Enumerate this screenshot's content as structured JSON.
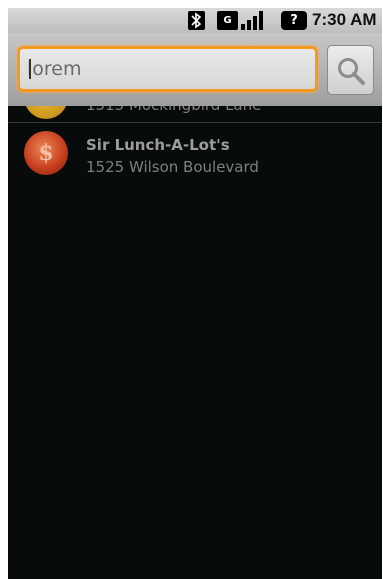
{
  "status_bar": {
    "data_icon_label": "G",
    "help_icon_label": "?",
    "time": "7:30 AM"
  },
  "search": {
    "value": "lorem",
    "placeholder": ""
  },
  "results": [
    {
      "name": "",
      "address": "1515 Mockingbird Lane",
      "avatar_letter": ""
    },
    {
      "name": "Sir Lunch-A-Lot's",
      "address": "1525 Wilson Boulevard",
      "avatar_letter": "$"
    }
  ]
}
